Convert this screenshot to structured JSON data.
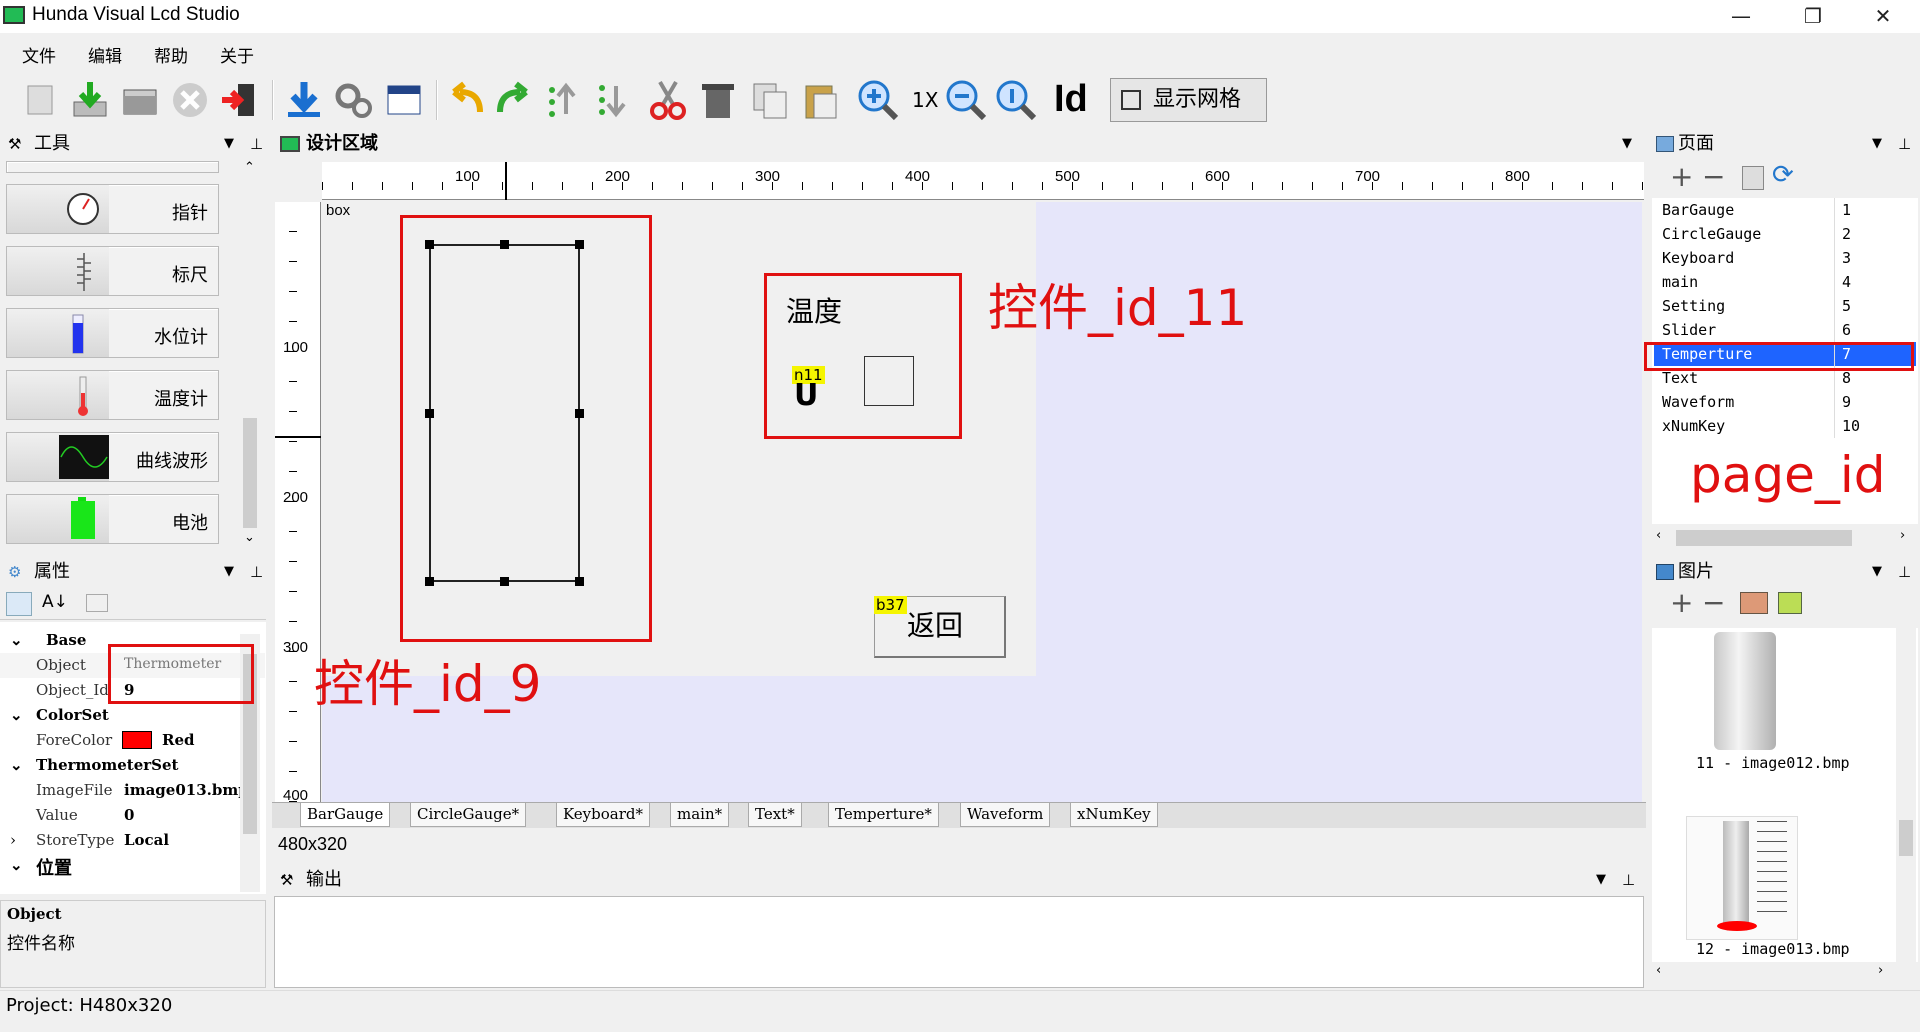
{
  "window": {
    "title": "Hunda Visual Lcd Studio",
    "minimize": "—",
    "restore": "❐",
    "close": "✕"
  },
  "menu": [
    "文件",
    "编辑",
    "帮助",
    "关于"
  ],
  "toolbar": {
    "zoom_label": "1X",
    "id_label": "Id",
    "grid_label": "显示网格"
  },
  "tools_panel": {
    "title": "工具",
    "items": [
      "指针",
      "标尺",
      "水位计",
      "温度计",
      "曲线波形",
      "电池"
    ]
  },
  "props_panel": {
    "title": "属性",
    "rows": [
      {
        "type": "cat",
        "key": "Base"
      },
      {
        "type": "prop",
        "key": "Object",
        "value": "Thermometer"
      },
      {
        "type": "prop",
        "key": "Object_Id",
        "value": "9"
      },
      {
        "type": "cat",
        "key": "ColorSet"
      },
      {
        "type": "prop",
        "key": "ForeColor",
        "value": "Red"
      },
      {
        "type": "cat",
        "key": "ThermometerSet"
      },
      {
        "type": "prop",
        "key": "ImageFile",
        "value": "image013.bmp"
      },
      {
        "type": "prop",
        "key": "Value",
        "value": "0"
      },
      {
        "type": "prop",
        "key": "StoreType",
        "value": "Local"
      },
      {
        "type": "cat",
        "key": "位置"
      }
    ],
    "desc_title": "Object",
    "desc_text": "控件名称",
    "forecolor_hex": "#ff0000"
  },
  "design": {
    "title": "设计区域",
    "ruler_h": [
      "100",
      "200",
      "300",
      "400",
      "500",
      "600",
      "700",
      "800"
    ],
    "ruler_v": [
      "100",
      "200",
      "300",
      "400"
    ],
    "canvas_label": "box",
    "text_label": "温度",
    "badge_n11": "n11",
    "badge_b37": "b37",
    "return_button": "返回",
    "annotation_id_11": "控件_id_11",
    "annotation_id_9": "控件_id_9",
    "size_label": "480x320",
    "page_tabs": [
      "BarGauge",
      "CircleGauge*",
      "Keyboard*",
      "main*",
      "Text*",
      "Temperture*",
      "Waveform",
      "xNumKey"
    ]
  },
  "output_panel": {
    "title": "输出"
  },
  "pages_panel": {
    "title": "页面",
    "annotation": "page_id",
    "selected": "Temperture",
    "pages": [
      {
        "name": "BarGauge",
        "id": "1"
      },
      {
        "name": "CircleGauge",
        "id": "2"
      },
      {
        "name": "Keyboard",
        "id": "3"
      },
      {
        "name": "main",
        "id": "4"
      },
      {
        "name": "Setting",
        "id": "5"
      },
      {
        "name": "Slider",
        "id": "6"
      },
      {
        "name": "Temperture",
        "id": "7"
      },
      {
        "name": "Text",
        "id": "8"
      },
      {
        "name": "Waveform",
        "id": "9"
      },
      {
        "name": "xNumKey",
        "id": "10"
      }
    ]
  },
  "images_panel": {
    "title": "图片",
    "items": [
      "11 - image012.bmp",
      "12 - image013.bmp"
    ]
  },
  "status": {
    "project": "Project: H480x320"
  },
  "colors": {
    "annotation_red": "#e01010",
    "selection_blue": "#1e64ff",
    "badge_yellow": "#f5f500"
  }
}
